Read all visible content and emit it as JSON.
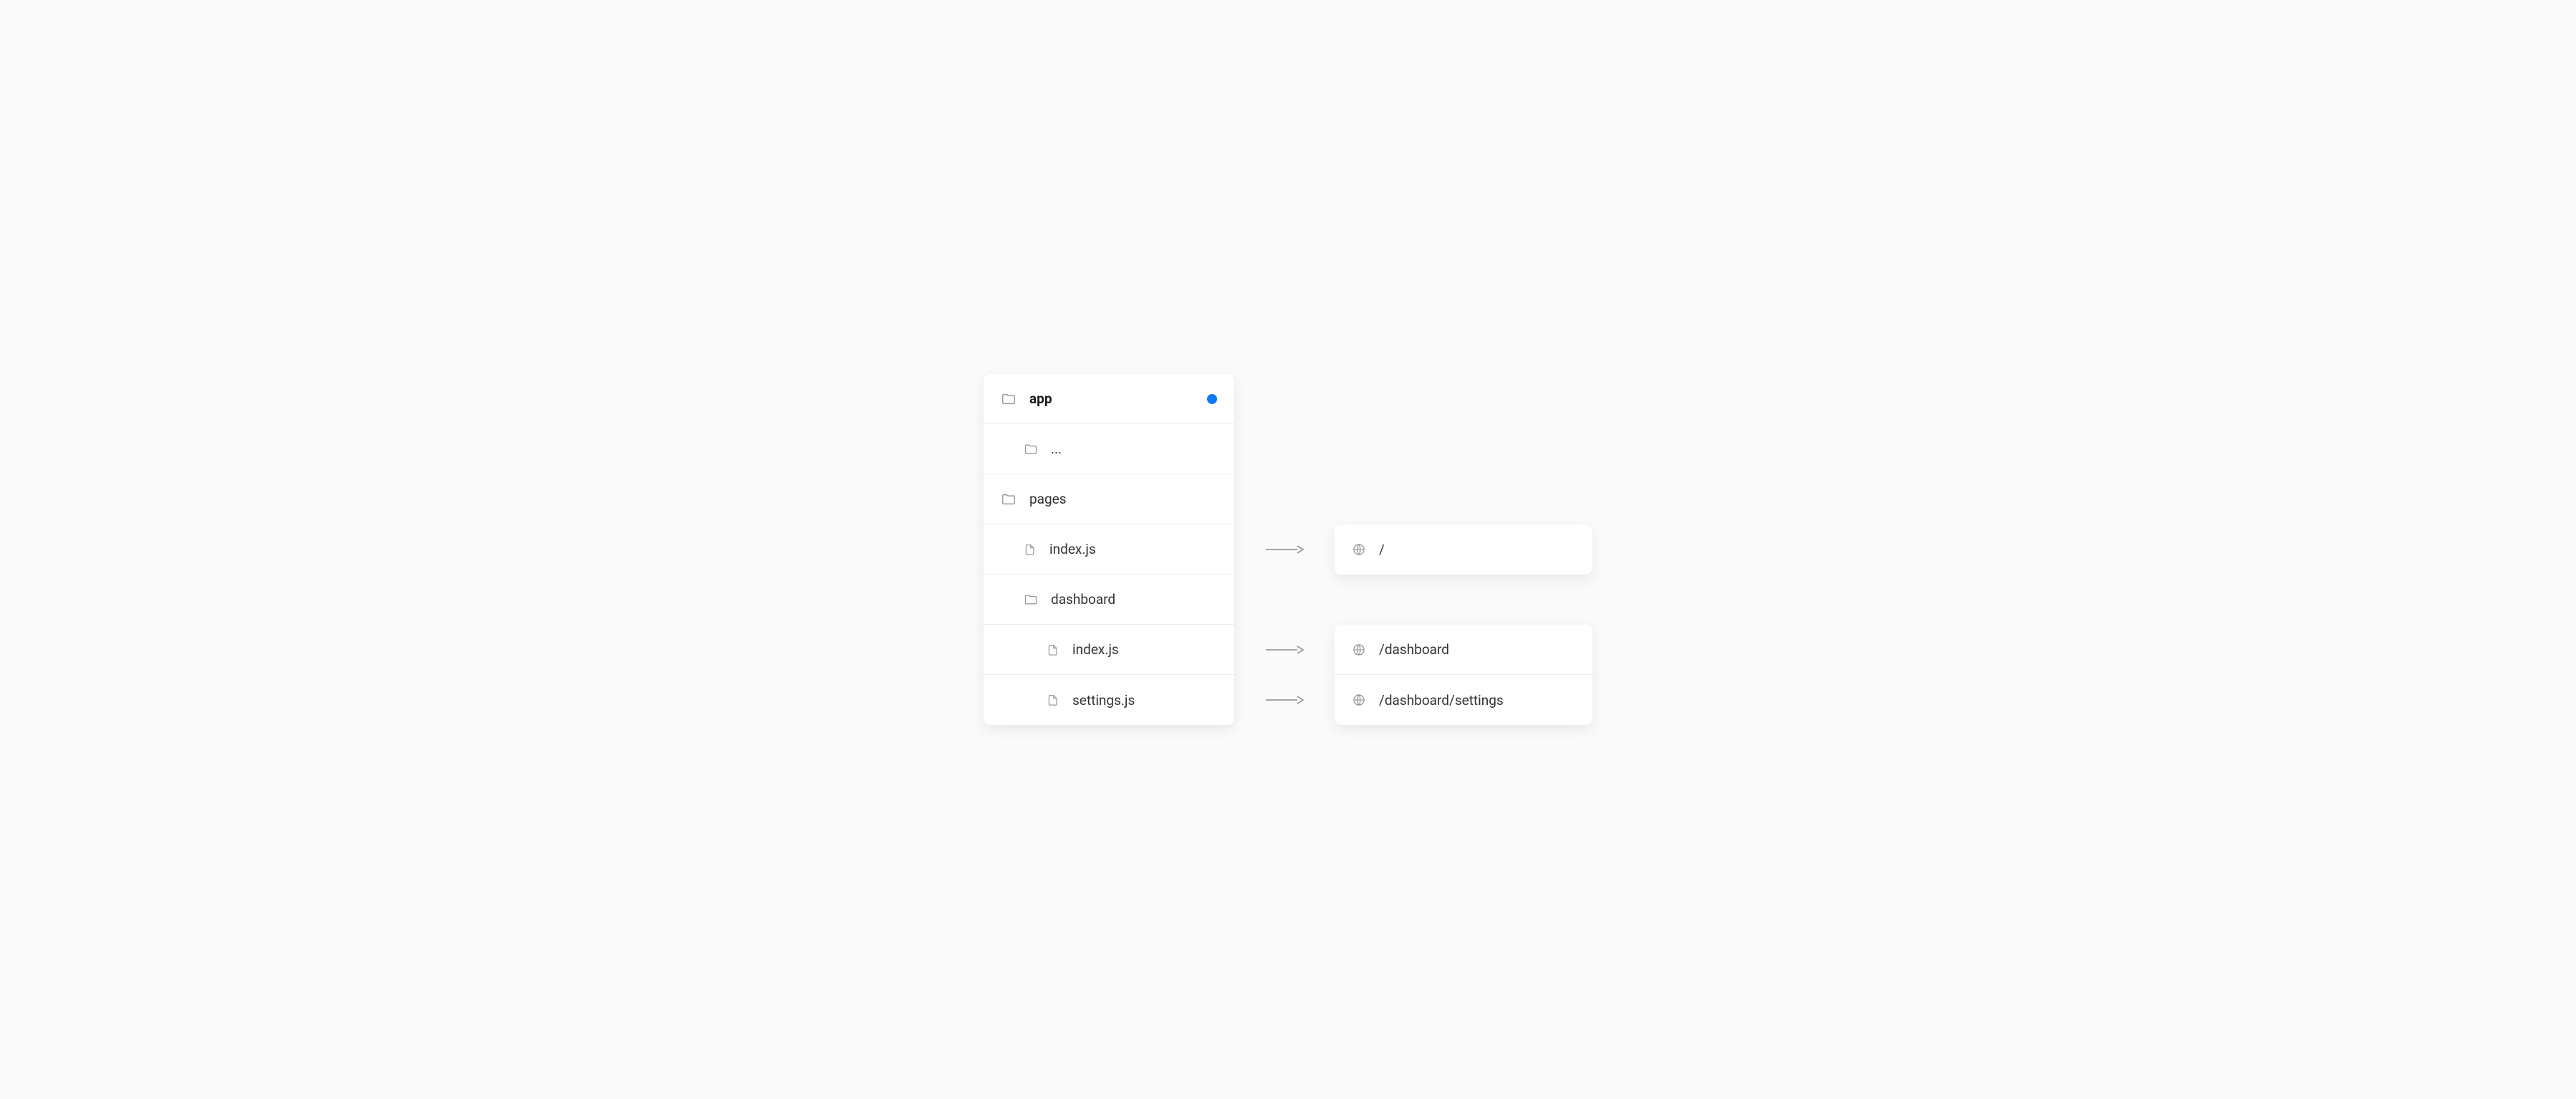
{
  "accent_color": "#0a7aff",
  "tree": {
    "root": {
      "label": "app",
      "marked": true
    },
    "ellipsis": "...",
    "pages_label": "pages",
    "items": [
      {
        "label": "index.js",
        "route_index": 0
      },
      {
        "label": "dashboard",
        "type": "folder"
      },
      {
        "label": "index.js",
        "route_index": 1
      },
      {
        "label": "settings.js",
        "route_index": 2
      }
    ]
  },
  "routes": [
    {
      "path": "/"
    },
    {
      "path": "/dashboard"
    },
    {
      "path": "/dashboard/settings"
    }
  ]
}
